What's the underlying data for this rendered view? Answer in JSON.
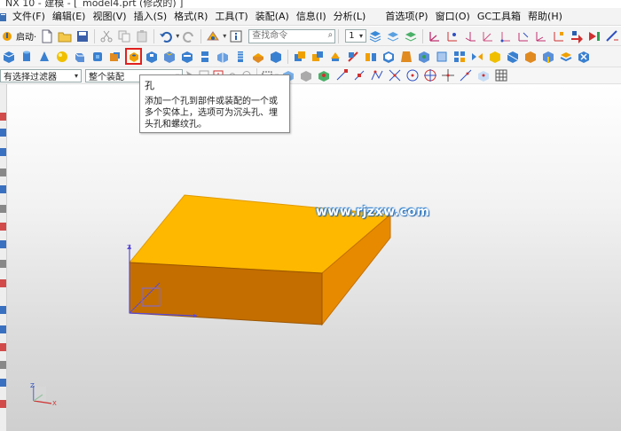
{
  "window": {
    "title": "NX 10 - 建模 - [_model4.prt  (修改的)  ]"
  },
  "menubar": {
    "items": [
      "文件(F)",
      "编辑(E)",
      "视图(V)",
      "插入(S)",
      "格式(R)",
      "工具(T)",
      "装配(A)",
      "信息(I)",
      "分析(L)"
    ],
    "right_items": [
      "首选项(P)",
      "窗口(O)",
      "GC工具箱",
      "帮助(H)"
    ]
  },
  "toolbar1": {
    "start_label": "启动·",
    "search_placeholder": "查找命令",
    "layer_value": "1"
  },
  "selection_bar": {
    "filter_value": "有选择过滤器",
    "scope_value": "整个装配"
  },
  "tooltip": {
    "title": "孔",
    "description": "添加一个孔到部件或装配的一个或多个实体上，选项可为沉头孔、埋头孔和螺纹孔。"
  },
  "watermark": {
    "text": "www.rjzxw.com"
  },
  "colors": {
    "block_top": "#ffb800",
    "block_right": "#e88a00",
    "block_front": "#c46e00",
    "highlight": "#e02020",
    "axis_blue": "#5a4bd8"
  }
}
